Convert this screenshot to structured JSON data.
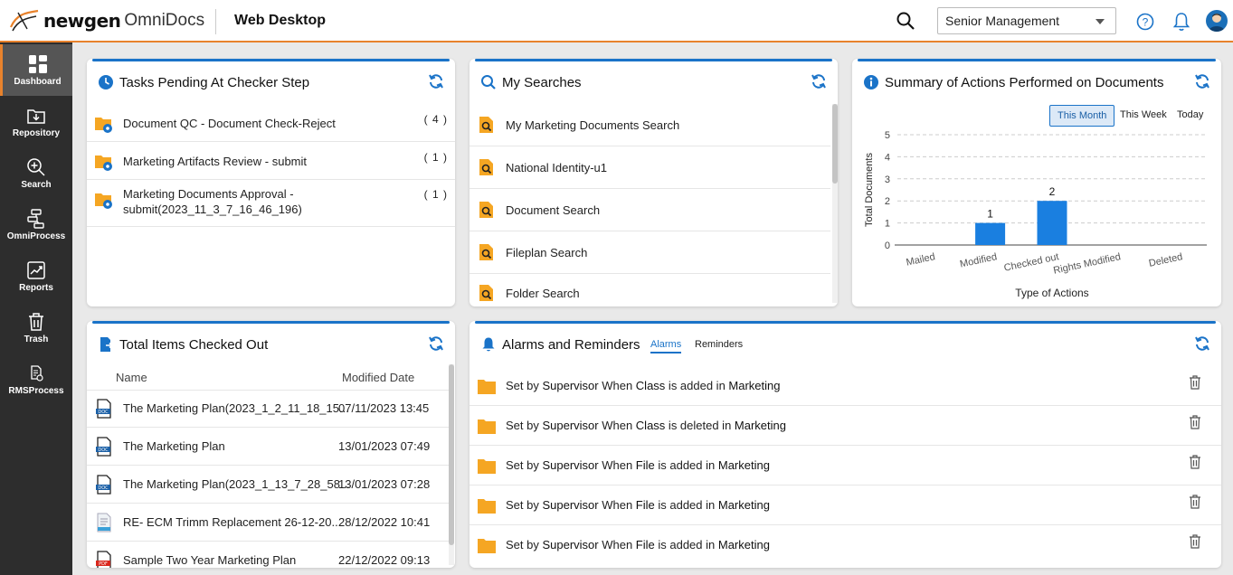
{
  "header": {
    "logo_word": "newgen",
    "logo_sub": "OmniDocs",
    "app_title": "Web Desktop",
    "role": "Senior Management"
  },
  "sidebar": {
    "items": [
      {
        "label": "Dashboard"
      },
      {
        "label": "Repository"
      },
      {
        "label": "Search"
      },
      {
        "label": "OmniProcess"
      },
      {
        "label": "Reports"
      },
      {
        "label": "Trash"
      },
      {
        "label": "RMSProcess"
      }
    ]
  },
  "tasks": {
    "title": "Tasks Pending At Checker Step",
    "items": [
      {
        "label": "Document QC - Document Check-Reject",
        "count": "( 4 )"
      },
      {
        "label": "Marketing Artifacts Review - submit",
        "count": "( 1 )"
      },
      {
        "label_line1": "Marketing Documents Approval -",
        "label_line2": "submit(2023_11_3_7_16_46_196)",
        "count": "( 1 )"
      }
    ]
  },
  "searches": {
    "title": "My Searches",
    "items": [
      {
        "label": "My Marketing Documents Search"
      },
      {
        "label": "National Identity-u1"
      },
      {
        "label": "Document Search"
      },
      {
        "label": "Fileplan Search"
      },
      {
        "label": "Folder Search"
      }
    ]
  },
  "summary": {
    "title": "Summary of Actions Performed on Documents",
    "periods": [
      "This Month",
      "This Week",
      "Today"
    ],
    "active_period": "This Month"
  },
  "chart_data": {
    "type": "bar",
    "categories": [
      "Mailed",
      "Modified",
      "Checked out",
      "Rights Modified",
      "Deleted"
    ],
    "values": [
      0,
      1,
      2,
      0,
      0
    ],
    "data_labels": [
      "",
      "1",
      "2",
      "",
      ""
    ],
    "xlabel": "Type of Actions",
    "ylabel": "Total Documents",
    "ylim": [
      0,
      5
    ],
    "yticks": [
      "0",
      "1",
      "2",
      "3",
      "4",
      "5"
    ],
    "grid": true,
    "bar_color": "#1a7fe0"
  },
  "checked_out": {
    "title": "Total Items Checked Out",
    "col_name": "Name",
    "col_date": "Modified Date",
    "rows": [
      {
        "name": "The Marketing Plan(2023_1_2_11_18_15...",
        "date": "07/11/2023 13:45",
        "icon": "doc-icon"
      },
      {
        "name": "The Marketing Plan",
        "date": "13/01/2023 07:49",
        "icon": "doc-icon"
      },
      {
        "name": "The Marketing Plan(2023_1_13_7_28_58...",
        "date": "13/01/2023 07:28",
        "icon": "doc-icon"
      },
      {
        "name": "RE- ECM Trimm Replacement 26-12-20...",
        "date": "28/12/2022 10:41",
        "icon": "email-icon"
      },
      {
        "name": "Sample Two Year Marketing Plan",
        "date": "22/12/2022 09:13",
        "icon": "pdf-icon"
      }
    ]
  },
  "alarms": {
    "title": "Alarms and Reminders",
    "tabs": [
      "Alarms",
      "Reminders"
    ],
    "items": [
      {
        "p1": "Set by ",
        "who": "Supervisor",
        "p2": " When ",
        "what": "Class",
        "p3": " is added in ",
        "where": "Marketing"
      },
      {
        "p1": "Set by ",
        "who": "Supervisor",
        "p2": " When ",
        "what": "Class",
        "p3": " is deleted in ",
        "where": "Marketing"
      },
      {
        "p1": "Set by ",
        "who": "Supervisor",
        "p2": " When ",
        "what": "File",
        "p3": " is added in ",
        "where": "Marketing"
      },
      {
        "p1": "Set by ",
        "who": "Supervisor",
        "p2": " When ",
        "what": "File",
        "p3": " is added in ",
        "where": "Marketing"
      },
      {
        "p1": "Set by ",
        "who": "Supervisor",
        "p2": " When ",
        "what": "File",
        "p3": " is added in ",
        "where": "Marketing"
      }
    ]
  },
  "colors": {
    "accent": "#e8822c",
    "primary": "#1a73c8",
    "sidebar": "#2d2d2d",
    "folder": "#f5a623"
  }
}
